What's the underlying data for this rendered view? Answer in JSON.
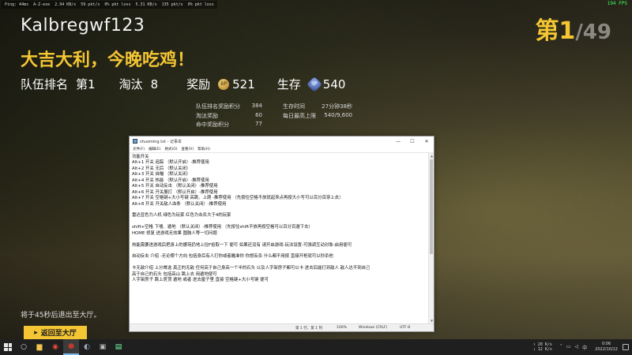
{
  "overlay": {
    "stats": [
      "Ping: 44ms",
      "A-Z-exe",
      "2.94 KB/s",
      "59 pkt/s",
      "0% pkt loss",
      "5.31 KB/s",
      "135 pkt/s",
      "0% pkt loss"
    ],
    "fps": "194 FPS"
  },
  "result": {
    "player_name": "Kalbregwf123",
    "headline": "大吉大利，今晚吃鸡！",
    "rank_current": "第1",
    "rank_total": "/49",
    "team_rank_label": "队伍排名",
    "team_rank_value": "第1",
    "kills_label": "淘汰",
    "kills_value": "8",
    "reward_label": "奖励",
    "bp_icon": "BP",
    "bp_value": "521",
    "survival_label": "生存",
    "sp_value": "540",
    "sp_icon": "SP"
  },
  "details_left": [
    {
      "label": "队伍排名奖励积分",
      "value": "384"
    },
    {
      "label": "淘汰奖励",
      "value": "60"
    },
    {
      "label": "命中奖励积分",
      "value": "77"
    }
  ],
  "details_right": [
    {
      "label": "生存时间",
      "value": "27分钟38秒"
    },
    {
      "label": "每日最高上限",
      "value": "540/9,600"
    }
  ],
  "exit": {
    "hint": "将于45秒后退出至大厅。",
    "button_label": "返回至大厅"
  },
  "notepad": {
    "title": "shuoming.txt - 记事本",
    "menu": [
      "文件(F)",
      "编辑(E)",
      "格式(O)",
      "查看(V)",
      "帮助(H)"
    ],
    "lines": [
      "功能开关",
      "Alt+1 开关 追踪  （默认开启）-推荐使用",
      "Alt+2 开关 无后  （默认关闭）",
      "Alt+3 开关 自瞄  （默认关闭）",
      "Alt+4 开关 热能  （默认开启）-推荐使用",
      "Alt+5 开关 自动反击  （默认关闭）-推荐使用",
      "Alt+6 开关 开关展打  （默认开启）-推荐使用",
      "Alt+7 开关 空格键+大小写键  高跳、上爬  -推荐使用  （先按住空格不放就起来点再按大小写可以百分百穿上去）",
      "Alt+8 开关 开关敌人血条  （默认关闭）-推荐使用",
      "",
      "雷达显色为人机  绿色为玩家  红色为击杀大于4的玩家",
      "",
      "shift+空格 下墙、遁地  （默认关闭）-推荐使用  （先按住shift不放再按空格可以百分百遁下去）",
      "HOME 修复 进游戏无效果 圆鼓人等一切问题",
      "",
      "热能需要进游戏后把身上的娜苑扔地上捡F拾取一下 便可 如果还没有 请开启游戏-玩法设置-可强调互动对象-启用便可",
      "",
      "自动反击 介绍 -无论哪个方向 包括身后有人打你或者瞄准你 你想反杀 什么都不用按 直接开枪就可以秒杀他",
      "",
      "卡无敌介绍  上分首选 真正的无敌  任何高于自己身高一个半的石头 以及人字架房子都可以卡 进去后能打到敌人 敌人达不到自己",
      "高于自己的石头 包括高山 跳上去 用遁地便可",
      "人字架房子 跳上房顶 遁地 或者 进去屋子里 直接 空格键+大小写键  便可"
    ],
    "status": {
      "position": "第 1 行，第 1 列",
      "zoom": "100%",
      "eol": "Windows (CRLF)",
      "encoding": "UTF-8"
    }
  },
  "taskbar": {
    "items": [
      "start-icon",
      "search-icon",
      "folder-icon",
      "chrome-icon",
      "steam-icon",
      "pubg-icon",
      "app-icon",
      "app-icon",
      "app-icon"
    ],
    "net_up": "↑ 20 K/s",
    "net_down": "↓ 12 K/s",
    "input_method": "中",
    "time": "0:06",
    "date": "2022/10/12"
  }
}
